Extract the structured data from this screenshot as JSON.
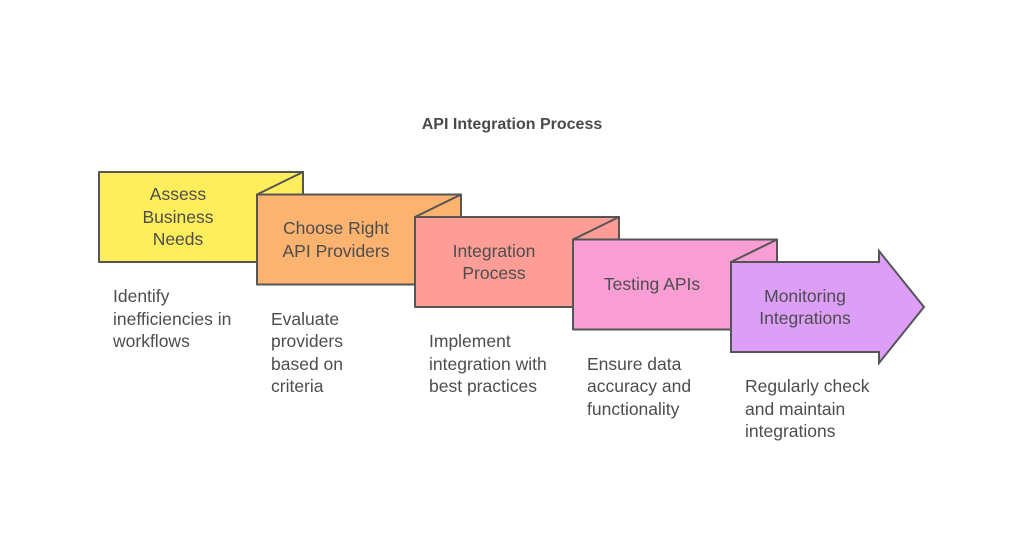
{
  "title": "API Integration Process",
  "steps": [
    {
      "label": "Assess\nBusiness\nNeeds",
      "description": "Identify\ninefficiencies in\nworkflows",
      "color": "#FFEE5C"
    },
    {
      "label": "Choose Right\nAPI Providers",
      "description": "Evaluate\nproviders\nbased on\ncriteria",
      "color": "#FCB36F"
    },
    {
      "label": "Integration\nProcess",
      "description": "Implement\nintegration with\nbest practices",
      "color": "#FE9C96"
    },
    {
      "label": "Testing APIs",
      "description": "Ensure data\naccuracy and\nfunctionality",
      "color": "#F89ED5"
    },
    {
      "label": "Monitoring\nIntegrations",
      "description": "Regularly check\nand maintain\nintegrations",
      "color": "#DD9EF7"
    }
  ],
  "stroke_color": "#555555"
}
